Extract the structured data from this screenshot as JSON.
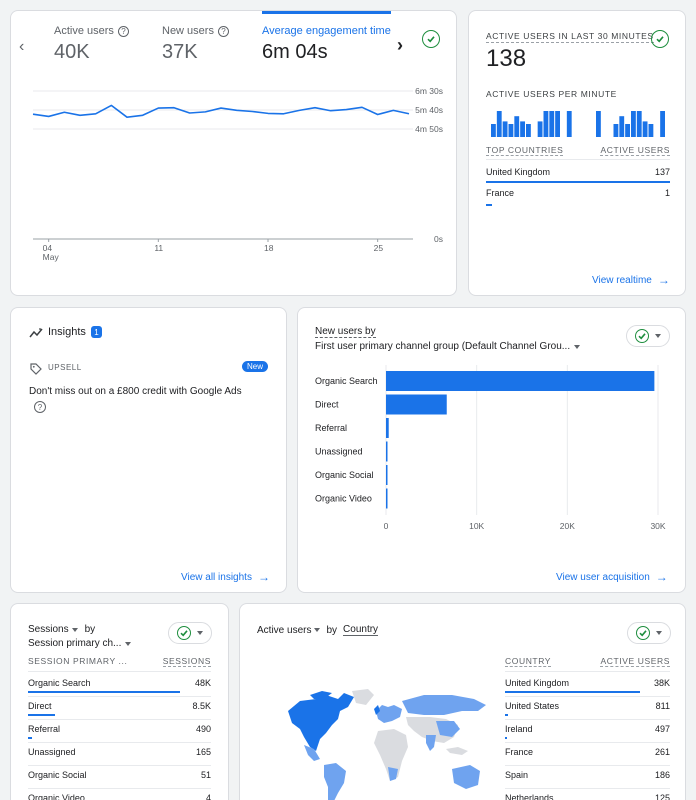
{
  "overview": {
    "metrics": [
      {
        "label": "Active users",
        "value": "40K"
      },
      {
        "label": "New users",
        "value": "37K"
      },
      {
        "label": "Average engagement time",
        "value": "6m 04s"
      }
    ],
    "y_ticks": [
      "6m 30s",
      "5m 40s",
      "4m 50s",
      "0s"
    ],
    "x_ticks": [
      "04",
      "11",
      "18",
      "25"
    ],
    "x_sub": "May",
    "chart_data": {
      "type": "line",
      "series": [
        {
          "values": [
            329,
            323,
            334,
            326,
            330,
            352,
            321,
            326,
            345,
            346,
            332,
            335,
            345,
            339,
            336,
            331,
            330,
            339,
            346,
            338,
            341,
            347,
            328,
            339,
            330
          ]
        }
      ],
      "ylim": [
        0,
        390
      ],
      "ytick_values": [
        390,
        340,
        290,
        0
      ]
    }
  },
  "realtime": {
    "title": "ACTIVE USERS IN LAST 30 MINUTES",
    "value": "138",
    "per_minute_label": "ACTIVE USERS PER MINUTE",
    "per_minute": [
      5,
      10,
      6,
      5,
      8,
      6,
      5,
      0,
      6,
      10,
      10,
      10,
      0,
      10,
      0,
      0,
      0,
      0,
      10,
      0,
      0,
      5,
      8,
      5,
      10,
      10,
      6,
      5,
      0,
      10
    ],
    "col_country": "TOP COUNTRIES",
    "col_users": "ACTIVE USERS",
    "rows": [
      {
        "country": "United Kingdom",
        "users": "137",
        "frac": 1.0
      },
      {
        "country": "France",
        "users": "1",
        "frac": 0.03
      }
    ],
    "link": "View realtime"
  },
  "insights": {
    "title": "Insights",
    "badge": "1",
    "tag": "UPSELL",
    "new_badge": "New",
    "message": "Don't miss out on a £800 credit with Google Ads",
    "link": "View all insights"
  },
  "acquisition": {
    "title_line1": "New users by",
    "title_line2": "First user primary channel group (Default Channel Grou...",
    "link": "View user acquisition",
    "chart_data": {
      "type": "bar",
      "orientation": "horizontal",
      "categories": [
        "Organic Search",
        "Direct",
        "Referral",
        "Unassigned",
        "Organic Social",
        "Organic Video"
      ],
      "values": [
        29600,
        6700,
        300,
        100,
        90,
        60
      ],
      "xlim": [
        0,
        30000
      ],
      "xticks": [
        "0",
        "10K",
        "20K",
        "30K"
      ],
      "xtick_values": [
        0,
        10000,
        20000,
        30000
      ]
    }
  },
  "sessions": {
    "title_line1": "Sessions",
    "title_by": "by",
    "title_line2": "Session primary ch...",
    "col_dim": "SESSION PRIMARY ...",
    "col_metric": "SESSIONS",
    "rows": [
      {
        "label": "Organic Search",
        "value": "48K",
        "frac": 0.83
      },
      {
        "label": "Direct",
        "value": "8.5K",
        "frac": 0.15
      },
      {
        "label": "Referral",
        "value": "490",
        "frac": 0.02
      },
      {
        "label": "Unassigned",
        "value": "165",
        "frac": 0
      },
      {
        "label": "Organic Social",
        "value": "51",
        "frac": 0
      },
      {
        "label": "Organic Video",
        "value": "4",
        "frac": 0
      }
    ]
  },
  "country": {
    "title_metric": "Active users",
    "title_by": "by",
    "title_dim": "Country",
    "col_country": "COUNTRY",
    "col_users": "ACTIVE USERS",
    "rows": [
      {
        "label": "United Kingdom",
        "value": "38K",
        "frac": 0.82
      },
      {
        "label": "United States",
        "value": "811",
        "frac": 0.02
      },
      {
        "label": "Ireland",
        "value": "497",
        "frac": 0.01
      },
      {
        "label": "France",
        "value": "261",
        "frac": 0
      },
      {
        "label": "Spain",
        "value": "186",
        "frac": 0
      },
      {
        "label": "Netherlands",
        "value": "125",
        "frac": 0
      }
    ]
  },
  "colors": {
    "accent": "#1a73e8",
    "success": "#1e8e3e",
    "map_light": "#6fa3ef",
    "map_grey": "#dadce0"
  }
}
